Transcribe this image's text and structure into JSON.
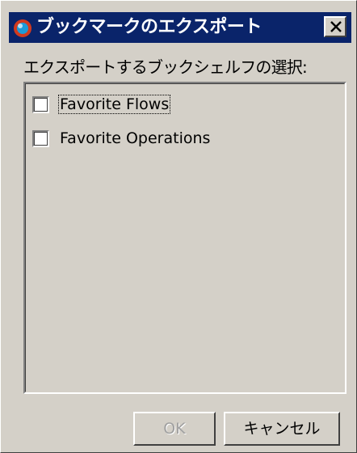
{
  "window": {
    "title": "ブックマークのエクスポート",
    "app_icon": "app-logo-icon",
    "close_icon": "close-icon",
    "title_bar_color": "#0a246a"
  },
  "dialog": {
    "section_label": "エクスポートするブックシェルフの選択:",
    "bookshelves": [
      {
        "label": "Favorite Flows",
        "checked": false
      },
      {
        "label": "Favorite Operations",
        "checked": false
      }
    ]
  },
  "buttons": {
    "ok_label": "OK",
    "ok_enabled": false,
    "cancel_label": "キャンセル"
  }
}
